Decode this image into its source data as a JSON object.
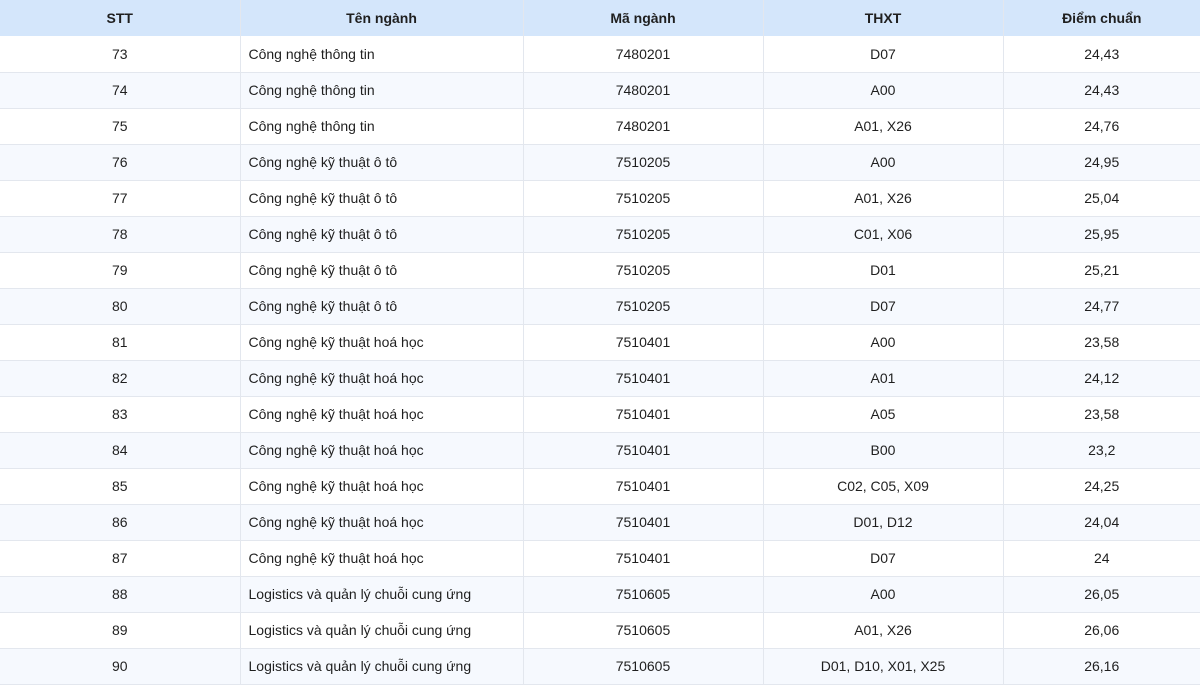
{
  "table": {
    "headers": [
      "STT",
      "Tên ngành",
      "Mã ngành",
      "THXT",
      "Điểm chuẩn"
    ],
    "rows": [
      [
        "73",
        "Công nghệ thông tin",
        "7480201",
        "D07",
        "24,43"
      ],
      [
        "74",
        "Công nghệ thông tin",
        "7480201",
        "A00",
        "24,43"
      ],
      [
        "75",
        "Công nghệ thông tin",
        "7480201",
        "A01, X26",
        "24,76"
      ],
      [
        "76",
        "Công nghệ kỹ thuật ô tô",
        "7510205",
        "A00",
        "24,95"
      ],
      [
        "77",
        "Công nghệ kỹ thuật ô tô",
        "7510205",
        "A01, X26",
        "25,04"
      ],
      [
        "78",
        "Công nghệ kỹ thuật ô tô",
        "7510205",
        "C01, X06",
        "25,95"
      ],
      [
        "79",
        "Công nghệ kỹ thuật ô tô",
        "7510205",
        "D01",
        "25,21"
      ],
      [
        "80",
        "Công nghệ kỹ thuật ô tô",
        "7510205",
        "D07",
        "24,77"
      ],
      [
        "81",
        "Công nghệ kỹ thuật hoá học",
        "7510401",
        "A00",
        "23,58"
      ],
      [
        "82",
        "Công nghệ kỹ thuật hoá học",
        "7510401",
        "A01",
        "24,12"
      ],
      [
        "83",
        "Công nghệ kỹ thuật hoá học",
        "7510401",
        "A05",
        "23,58"
      ],
      [
        "84",
        "Công nghệ kỹ thuật hoá học",
        "7510401",
        "B00",
        "23,2"
      ],
      [
        "85",
        "Công nghệ kỹ thuật hoá học",
        "7510401",
        "C02, C05, X09",
        "24,25"
      ],
      [
        "86",
        "Công nghệ kỹ thuật hoá học",
        "7510401",
        "D01, D12",
        "24,04"
      ],
      [
        "87",
        "Công nghệ kỹ thuật hoá học",
        "7510401",
        "D07",
        "24"
      ],
      [
        "88",
        "Logistics và quản lý chuỗi cung ứng",
        "7510605",
        "A00",
        "26,05"
      ],
      [
        "89",
        "Logistics và quản lý chuỗi cung ứng",
        "7510605",
        "A01, X26",
        "26,06"
      ],
      [
        "90",
        "Logistics và quản lý chuỗi cung ứng",
        "7510605",
        "D01, D10, X01, X25",
        "26,16"
      ]
    ]
  },
  "colors": {
    "header_bg": "#d4e6fb",
    "row_alt_bg": "#f6f9fe",
    "border": "#e3e7ee"
  }
}
